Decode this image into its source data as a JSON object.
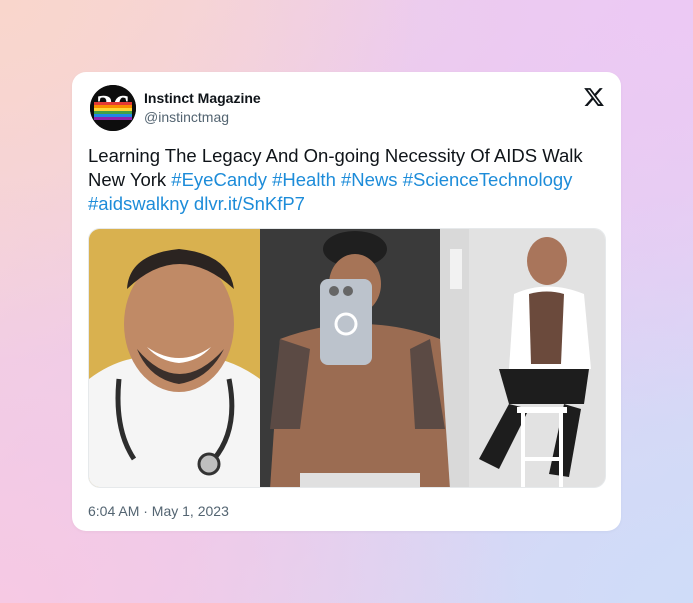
{
  "account": {
    "display_name": "Instinct Magazine",
    "handle": "@instinctmag",
    "avatar_icon": "instinct-magazine-logo"
  },
  "platform_icon": "x-logo-icon",
  "tweet": {
    "text_plain": "Learning The Legacy And On-going Necessity Of AIDS Walk New York",
    "hashtags": [
      "#EyeCandy",
      "#Health",
      "#News",
      "#ScienceTechnology",
      "#aidswalkny"
    ],
    "link": "dlvr.it/SnKfP7",
    "link_color": "#1d8cd9"
  },
  "media": {
    "images": [
      {
        "subject": "smiling man with stethoscope"
      },
      {
        "subject": "shirtless man taking mirror selfie"
      },
      {
        "subject": "man in open white shirt on stool"
      }
    ]
  },
  "timestamp": "6:04 AM · May 1, 2023"
}
